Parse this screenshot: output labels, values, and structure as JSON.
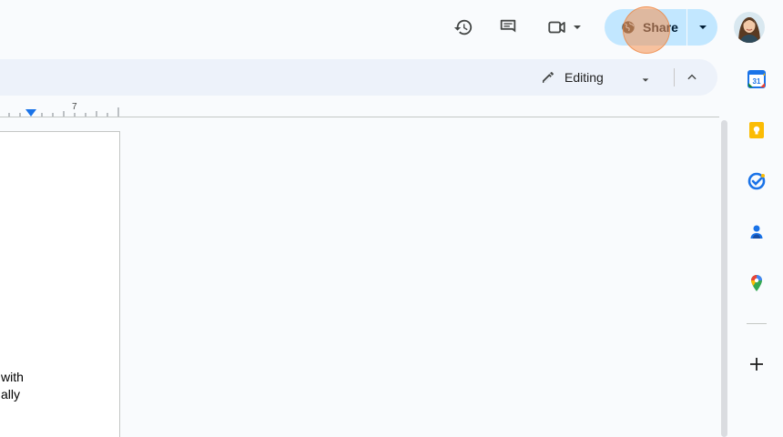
{
  "header": {
    "share_label": "Share",
    "icons": [
      "history-icon",
      "comments-icon",
      "meet-icon",
      "globe-icon",
      "avatar"
    ]
  },
  "toolbar": {
    "mode_label": "Editing",
    "icons": [
      "pencil-icon",
      "chevron-down-icon",
      "chevron-up-icon"
    ]
  },
  "ruler": {
    "number": "7"
  },
  "document": {
    "lines": [
      "with",
      "ally"
    ]
  },
  "side_panel": {
    "items": [
      "calendar-icon",
      "keep-icon",
      "tasks-icon",
      "contacts-icon",
      "maps-icon",
      "add-icon"
    ],
    "calendar_day": "31"
  },
  "colors": {
    "share_bg": "#c2e7ff",
    "toolbar_bg": "#edf2fa",
    "page_bg": "#f9fbfd",
    "click_highlight": "#f69250"
  }
}
